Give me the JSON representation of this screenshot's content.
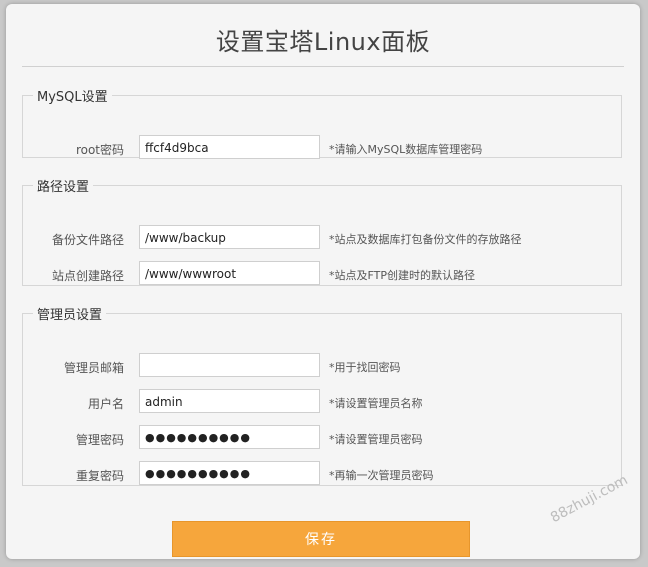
{
  "title": "设置宝塔Linux面板",
  "mysql": {
    "legend": "MySQL设置",
    "root_label": "root密码",
    "root_value": "ffcf4d9bca",
    "root_hint": "*请输入MySQL数据库管理密码"
  },
  "paths": {
    "legend": "路径设置",
    "backup_label": "备份文件路径",
    "backup_value": "/www/backup",
    "backup_hint": "*站点及数据库打包备份文件的存放路径",
    "site_label": "站点创建路径",
    "site_value": "/www/wwwroot",
    "site_hint": "*站点及FTP创建时的默认路径"
  },
  "admin": {
    "legend": "管理员设置",
    "email_label": "管理员邮箱",
    "email_value": "",
    "email_hint": "*用于找回密码",
    "user_label": "用户名",
    "user_value": "admin",
    "user_hint": "*请设置管理员名称",
    "pwd_label": "管理密码",
    "pwd_value": "●●●●●●●●●●",
    "pwd_hint": "*请设置管理员密码",
    "repeat_label": "重复密码",
    "repeat_value": "●●●●●●●●●●",
    "repeat_hint": "*再输一次管理员密码"
  },
  "save_label": "保存",
  "watermark": "88zhuji.com"
}
